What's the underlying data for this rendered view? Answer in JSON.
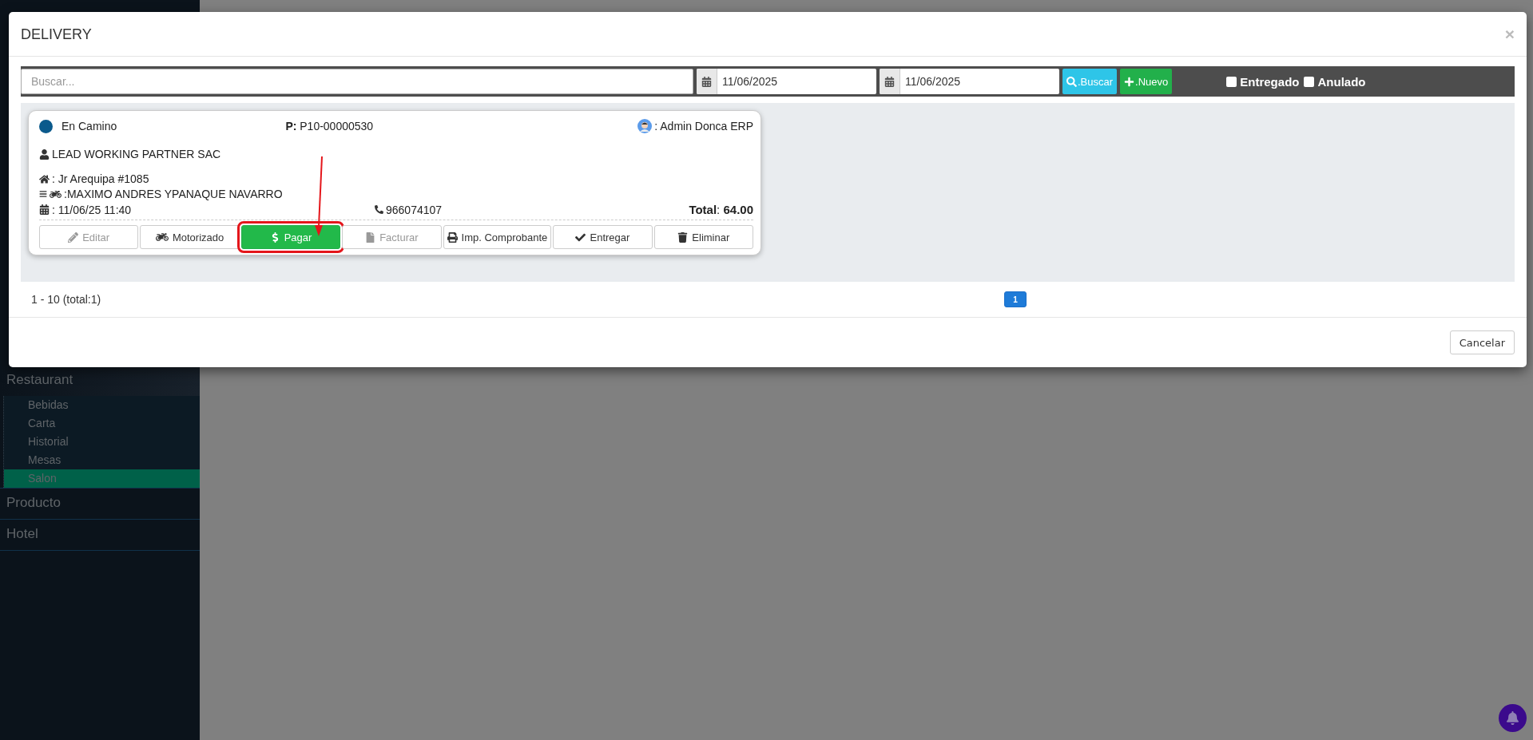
{
  "sidebar": {
    "items": [
      {
        "label": "Restaurant",
        "expanded": true,
        "children": [
          {
            "label": "Bebidas",
            "selected": false
          },
          {
            "label": "Carta",
            "selected": false
          },
          {
            "label": "Historial",
            "selected": false
          },
          {
            "label": "Mesas",
            "selected": false
          },
          {
            "label": "Salon",
            "selected": true
          }
        ]
      },
      {
        "label": "Producto",
        "expanded": false
      },
      {
        "label": "Hotel",
        "expanded": false
      }
    ]
  },
  "modal": {
    "title": "DELIVERY",
    "close": "×",
    "toolbar": {
      "search": {
        "placeholder": "Buscar..."
      },
      "date_from": "11/06/2025",
      "date_to": "11/06/2025",
      "buttons": [
        {
          "label": ".Buscar",
          "kind": "search"
        },
        {
          "label": ".Nuevo",
          "kind": "add"
        }
      ],
      "filters": [
        {
          "label": "Entregado",
          "checked": false
        },
        {
          "label": "Anulado",
          "checked": false
        }
      ]
    },
    "orders": [
      {
        "status": "En Camino",
        "color": "#0b5a8c",
        "code": "**P:** P10-00000530",
        "user": ": Admin Donca ERP",
        "customer": "LEAD WORKING PARTNER SAC",
        "address": ": Jr Arequipa #1085",
        "driver": ":MAXIMO ANDRES YPANAQUE NAVARRO",
        "date": ": 11/06/25 11:40",
        "phone": "966074107",
        "total": "**Total**: **64.00**",
        "actions": [
          {
            "label": "Editar",
            "kind": "edit",
            "disabled": true,
            "highlighted": false
          },
          {
            "label": "Motorizado",
            "kind": "driver",
            "disabled": false,
            "highlighted": false
          },
          {
            "label": "Pagar",
            "kind": "pay",
            "disabled": false,
            "highlighted": true
          },
          {
            "label": "Facturar",
            "kind": "invoice",
            "disabled": true,
            "highlighted": false
          },
          {
            "label": "Imp. Comprobante",
            "kind": "print",
            "disabled": false,
            "highlighted": false
          },
          {
            "label": "Entregar",
            "kind": "deliver",
            "disabled": false,
            "highlighted": false
          },
          {
            "label": "Eliminar",
            "kind": "delete",
            "disabled": false,
            "highlighted": false
          }
        ]
      }
    ],
    "range": "1 - 10 (total:1)",
    "pages": [
      {
        "label": "1",
        "selected": true
      }
    ],
    "cancel": "Cancelar"
  }
}
